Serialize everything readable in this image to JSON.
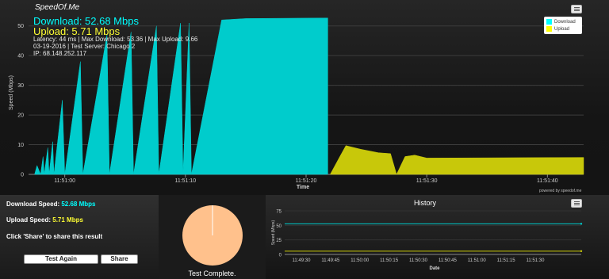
{
  "app": {
    "title": "SpeedOf.Me"
  },
  "header": {
    "download_line": "Download: 52.68 Mbps",
    "upload_line": "Upload: 5.71 Mbps",
    "latency_line": "Latency: 44 ms | Max Download: 53.36 | Max Upload: 9.66",
    "date_line": "03-19-2016 | Test Server: Chicago 2",
    "ip_line": "IP: 68.148.252.117"
  },
  "legend": {
    "download": "Download",
    "upload": "Upload"
  },
  "powered_by": "powered by speedof.me",
  "colors": {
    "download": "#00cccc",
    "upload": "#c8c80a",
    "download_text": "#00ffff",
    "upload_text": "#ffff33",
    "pie": "#ffc18c"
  },
  "icons": {
    "chart_menu": "hamburger-menu-icon",
    "history_menu": "hamburger-menu-icon"
  },
  "summary": {
    "download_label": "Download Speed:",
    "download_value": "52.68 Mbps",
    "upload_label": "Upload Speed:",
    "upload_value": "5.71 Mbps",
    "share_hint": "Click 'Share' to share this result",
    "test_again_label": "Test Again",
    "share_label": "Share"
  },
  "pie": {
    "caption": "Test Complete.",
    "progress": 1.0
  },
  "chart_data": [
    {
      "type": "area",
      "title": "",
      "xlabel": "Time",
      "ylabel": "Speed (Mbps)",
      "ylim": [
        0,
        55
      ],
      "yticks": [
        0,
        10,
        20,
        30,
        40,
        50
      ],
      "xlim": [
        "11:50:57",
        "11:51:43"
      ],
      "xticks": [
        "11:51:00",
        "11:51:10",
        "11:51:20",
        "11:51:30",
        "11:51:40"
      ],
      "grid": true,
      "legend_position": "top-right",
      "series": [
        {
          "name": "Download",
          "x": [
            "11:50:57.5",
            "11:50:57.7",
            "11:50:58.0",
            "11:50:58.2",
            "11:50:58.3",
            "11:50:58.6",
            "11:50:58.7",
            "11:50:59.0",
            "11:50:59.1",
            "11:50:59.8",
            "11:51:00.0",
            "11:51:01.3",
            "11:51:01.5",
            "11:51:03.5",
            "11:51:03.7",
            "11:51:05.5",
            "11:51:05.7",
            "11:51:07.6",
            "11:51:07.8",
            "11:51:09.6",
            "11:51:09.8",
            "11:51:10.3",
            "11:51:10.5",
            "11:51:13.0",
            "11:51:15.0",
            "11:51:21.8"
          ],
          "values": [
            0,
            3,
            0,
            6,
            0,
            9,
            0,
            11,
            0,
            25,
            0,
            38,
            0,
            47,
            0,
            48,
            0,
            50,
            0,
            51,
            0,
            51,
            0,
            52,
            52.5,
            52.68
          ]
        },
        {
          "name": "Upload",
          "x": [
            "11:51:22.0",
            "11:51:22.8",
            "11:51:23.3",
            "11:51:24.5",
            "11:51:26.0",
            "11:51:27.0",
            "11:51:27.5",
            "11:51:28.2",
            "11:51:29.0",
            "11:51:30.0",
            "11:51:43.0"
          ],
          "values": [
            0,
            6,
            9.7,
            8.5,
            7.3,
            7,
            0,
            6,
            6.5,
            5.5,
            5.71
          ]
        }
      ]
    },
    {
      "type": "line",
      "title": "History",
      "xlabel": "Date",
      "ylabel": "Speed (Mbps)",
      "ylim": [
        0,
        75
      ],
      "yticks": [
        0,
        25,
        50,
        75
      ],
      "xticks": [
        "11:49:30",
        "11:49:45",
        "11:50:00",
        "11:50:15",
        "11:50:30",
        "11:50:45",
        "11:51:00",
        "11:51:15",
        "11:51:30"
      ],
      "grid": true,
      "series": [
        {
          "name": "Download",
          "values": [
            52.68,
            52.68
          ]
        },
        {
          "name": "Upload",
          "values": [
            5.71,
            5.71
          ]
        }
      ]
    }
  ]
}
